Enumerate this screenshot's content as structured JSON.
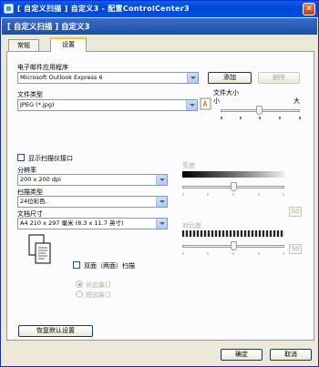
{
  "window": {
    "title": "[ 自定义扫描 ] 自定义3 - 配置ControlCenter3",
    "close_glyph": "✕"
  },
  "header": {
    "text": "[ 自定义扫描 ] 自定义3"
  },
  "tabs": [
    {
      "label": "常规",
      "active": false
    },
    {
      "label": "设置",
      "active": true
    }
  ],
  "email_app": {
    "label": "电子邮件应用程序",
    "value": "Microsoft Outlook Express 6",
    "add_label": "添加",
    "delete_label": "删除"
  },
  "file_type": {
    "label": "文件类型",
    "value": "JPEG (*.jpg)"
  },
  "file_size": {
    "label": "文件大小",
    "small": "小",
    "large": "大"
  },
  "show_scanner_interface": {
    "label": "显示扫描仪接口",
    "checked": false
  },
  "resolution": {
    "label": "分辨率",
    "value": "200 x 200 dpi"
  },
  "scan_type": {
    "label": "扫描类型",
    "value": "24位彩色"
  },
  "doc_size": {
    "label": "文档尺寸",
    "value": "A4 210 x 297 毫米 (8.3 x 11.7 英寸)"
  },
  "brightness": {
    "label": "亮度",
    "value": "50",
    "level": 0.5
  },
  "contrast": {
    "label": "对比度",
    "value": "50",
    "level": 0.5
  },
  "duplex": {
    "label": "双面（两面）扫描",
    "checked": false,
    "long_edge": "长边装订",
    "short_edge": "短边装订"
  },
  "restore_defaults_label": "恢复默认设置",
  "ok_label": "确定",
  "cancel_label": "取消",
  "colors": {
    "title_bar": "#0046d5",
    "header_bar": "#2a5cb8",
    "tab_accent": "#ffc73c"
  }
}
